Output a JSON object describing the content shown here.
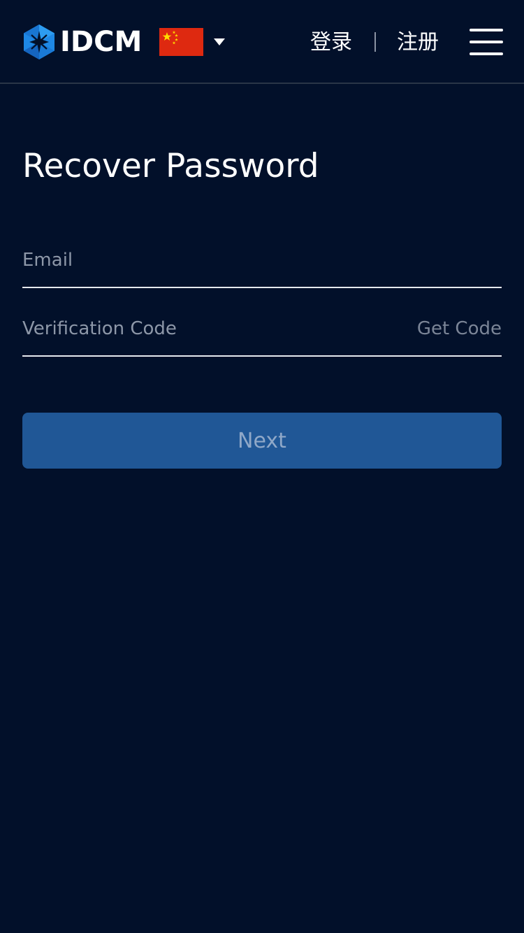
{
  "header": {
    "logo_text": "IDCM",
    "language_flag": "cn-flag-icon",
    "login_label": "登录",
    "register_label": "注册",
    "menu_icon": "hamburger-menu-icon"
  },
  "page": {
    "title": "Recover Password"
  },
  "form": {
    "email": {
      "value": "",
      "placeholder": "Email"
    },
    "verification_code": {
      "value": "",
      "placeholder": "Verification Code"
    },
    "get_code_label": "Get Code",
    "next_label": "Next"
  },
  "colors": {
    "background": "#02102a",
    "primary_button": "#205796",
    "button_text": "#8fa8c8",
    "placeholder_text": "#8d97a8",
    "get_code_text": "#7b8597",
    "logo_blue": "#1e88e5",
    "flag_red": "#de2910",
    "flag_star": "#ffde00"
  }
}
